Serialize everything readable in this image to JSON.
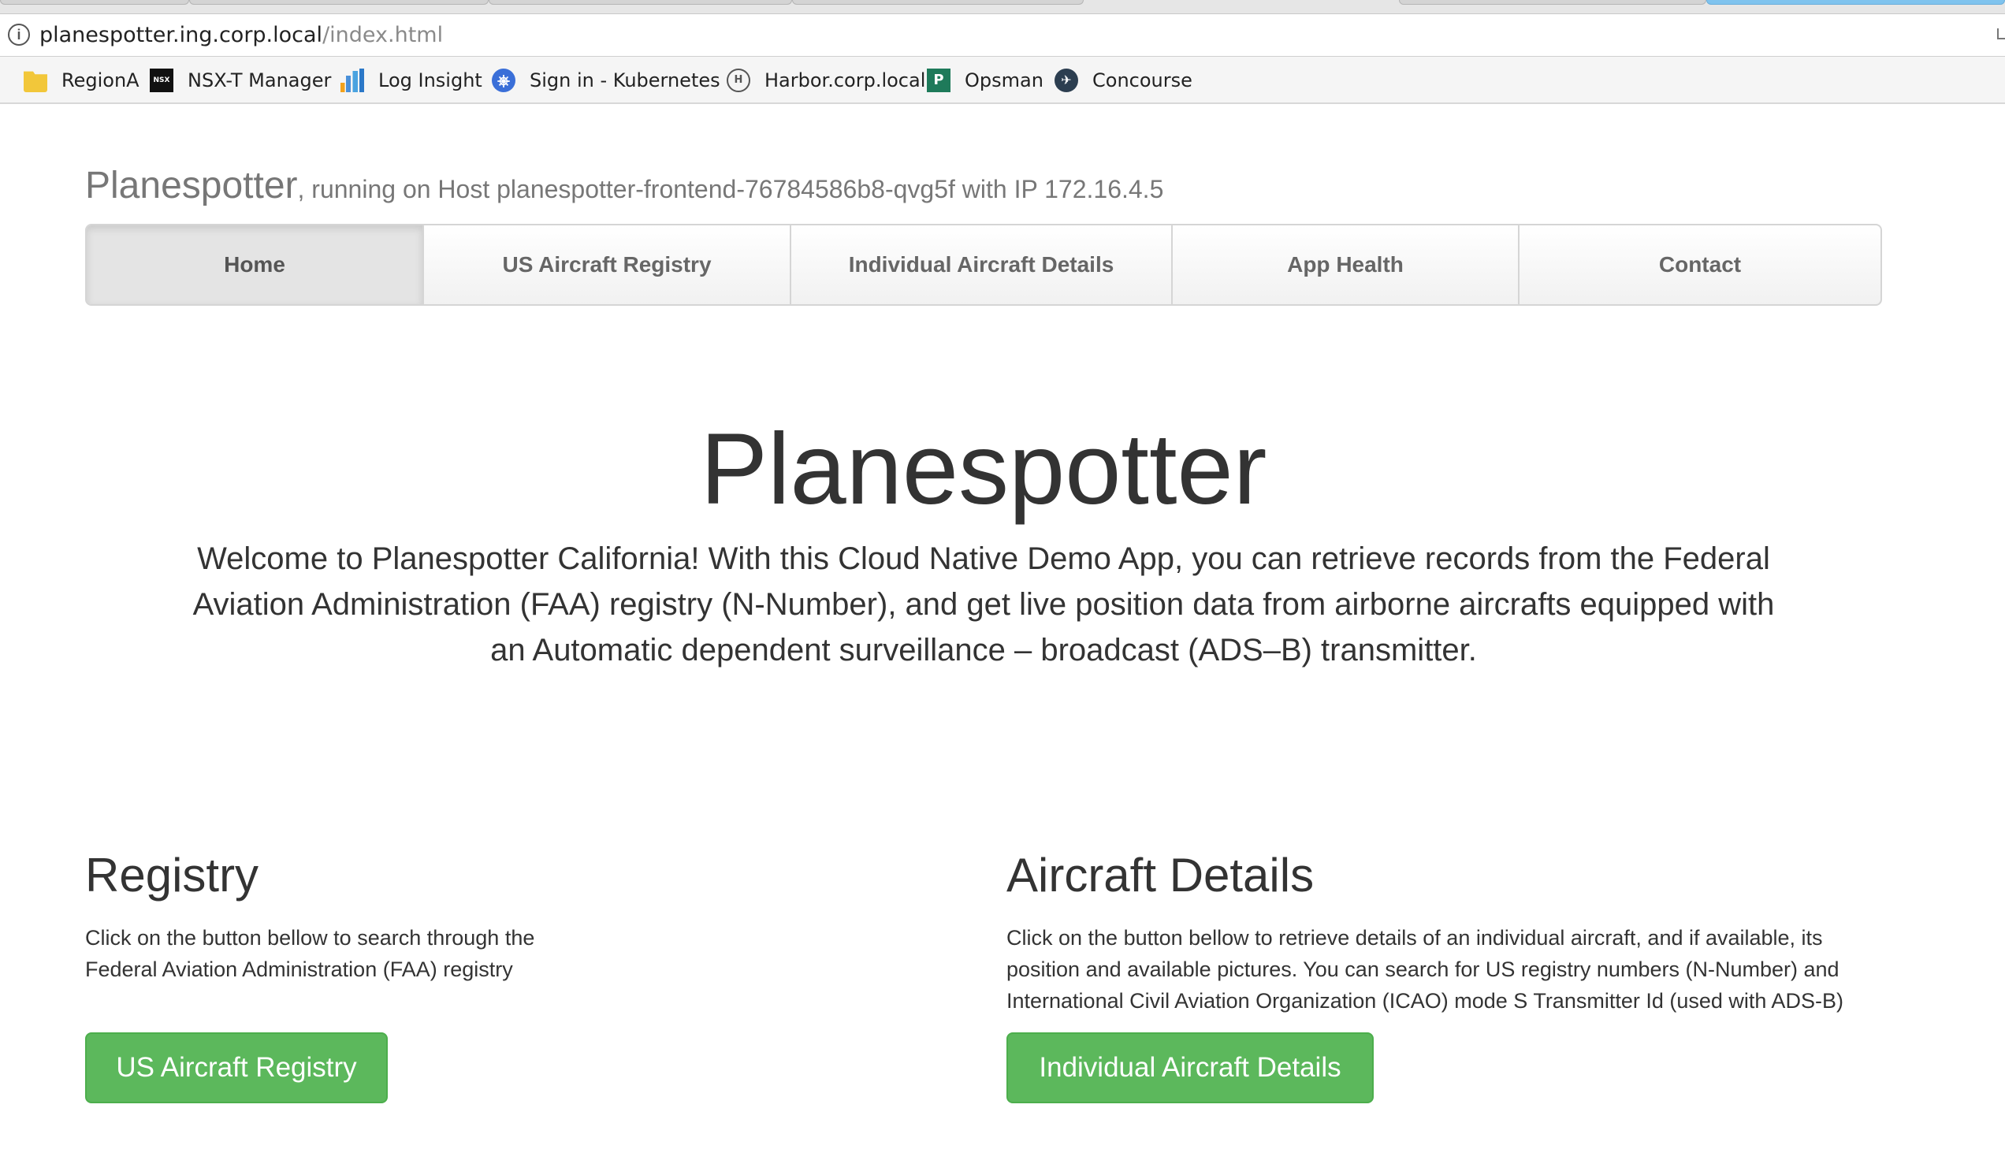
{
  "browser": {
    "url_host": "planespotter.ing.corp.local",
    "url_path": "/index.html",
    "bookmarks": [
      {
        "label": "RegionA",
        "icon": "folder-icon"
      },
      {
        "label": "NSX-T Manager",
        "icon": "nsx-icon"
      },
      {
        "label": "Log Insight",
        "icon": "log-insight-icon"
      },
      {
        "label": "Sign in - Kubernetes",
        "icon": "kubernetes-icon"
      },
      {
        "label": "Harbor.corp.local",
        "icon": "harbor-icon"
      },
      {
        "label": "Opsman",
        "icon": "opsman-icon"
      },
      {
        "label": "Concourse",
        "icon": "concourse-icon"
      }
    ]
  },
  "header": {
    "brand": "Planespotter",
    "host_info": ", running on Host planespotter-frontend-76784586b8-qvg5f with IP 172.16.4.5"
  },
  "nav": {
    "items": [
      {
        "label": "Home",
        "active": true
      },
      {
        "label": "US Aircraft Registry"
      },
      {
        "label": "Individual Aircraft Details"
      },
      {
        "label": "App Health"
      },
      {
        "label": "Contact"
      }
    ]
  },
  "hero": {
    "title": "Planespotter",
    "text": "Welcome to Planespotter California! With this Cloud Native Demo App, you can retrieve records from the Federal Aviation Administration (FAA) registry (N-Number), and get live position data from airborne aircrafts equipped with an Automatic dependent surveillance – broadcast (ADS–B) transmitter."
  },
  "registry": {
    "title": "Registry",
    "text": "Click on the button bellow to search through the Federal Aviation Administration (FAA) registry",
    "button": "US Aircraft Registry"
  },
  "details": {
    "title": "Aircraft Details",
    "text": "Click on the button bellow to retrieve details of an individual aircraft, and if available, its position and available pictures. You can search for US registry numbers (N-Number) and International Civil Aviation Organization (ICAO) mode S Transmitter Id (used with ADS-B)",
    "button": "Individual Aircraft Details"
  },
  "colors": {
    "success_button": "#5cb85c",
    "muted_text": "#777777",
    "body_text": "#333333"
  }
}
